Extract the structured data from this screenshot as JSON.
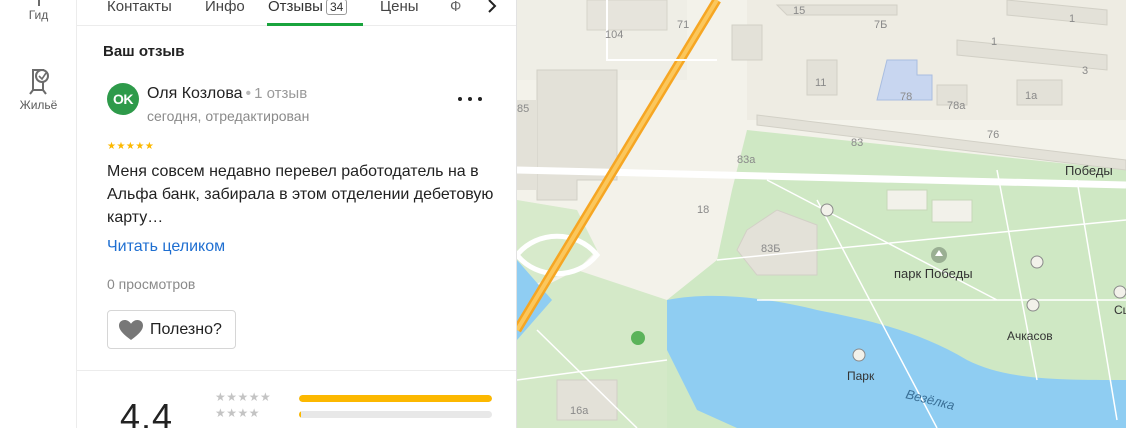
{
  "rail": {
    "guide_label": "Гид",
    "housing_label": "Жильё"
  },
  "tabs": [
    {
      "label": "Контакты"
    },
    {
      "label": "Инфо"
    },
    {
      "label": "Отзывы",
      "count": "34"
    },
    {
      "label": "Цены"
    },
    {
      "label": "Ф"
    }
  ],
  "review": {
    "section_title": "Ваш отзыв",
    "avatar_initials": "OK",
    "author": "Оля Козлова",
    "reviews_count": "1 отзыв",
    "date": "сегодня, отредактирован",
    "stars": "★★★★★",
    "text": "Меня совсем недавно перевел работодатель на в Альфа банк, забирала в этом отделении дебетовую карту…",
    "read_more": "Читать целиком",
    "views": "0 просмотров",
    "useful_label": "Полезно?"
  },
  "rating": {
    "value": "4.4",
    "histogram": [
      {
        "stars": "★★★★★",
        "fraction": 1.0
      },
      {
        "stars": "★★★★",
        "fraction": 0.01
      }
    ]
  },
  "map": {
    "labels": {
      "b104": "104",
      "b71": "71",
      "b15": "15",
      "b7b": "7Б",
      "b1": "1",
      "b1top": "1",
      "b3": "3",
      "b11": "11",
      "b78": "78",
      "b78a": "78а",
      "b1a": "1а",
      "b76": "76",
      "b85": "85",
      "b83": "83",
      "b83a": "83а",
      "b18": "18",
      "b83b": "83Б",
      "b16a": "16а",
      "street_pobedy": "Победы",
      "park_pobedy": "парк Победы",
      "achkasov": "Ачкасов",
      "park": "Парк",
      "sce": "Сцен",
      "river": "Везёлка"
    },
    "colors": {
      "land": "#f3f2ea",
      "park": "#cfe8c4",
      "water": "#8fcdf2",
      "highway": "#f6a623",
      "building": "#e6e4dc",
      "school": "#c8d6f0"
    }
  }
}
